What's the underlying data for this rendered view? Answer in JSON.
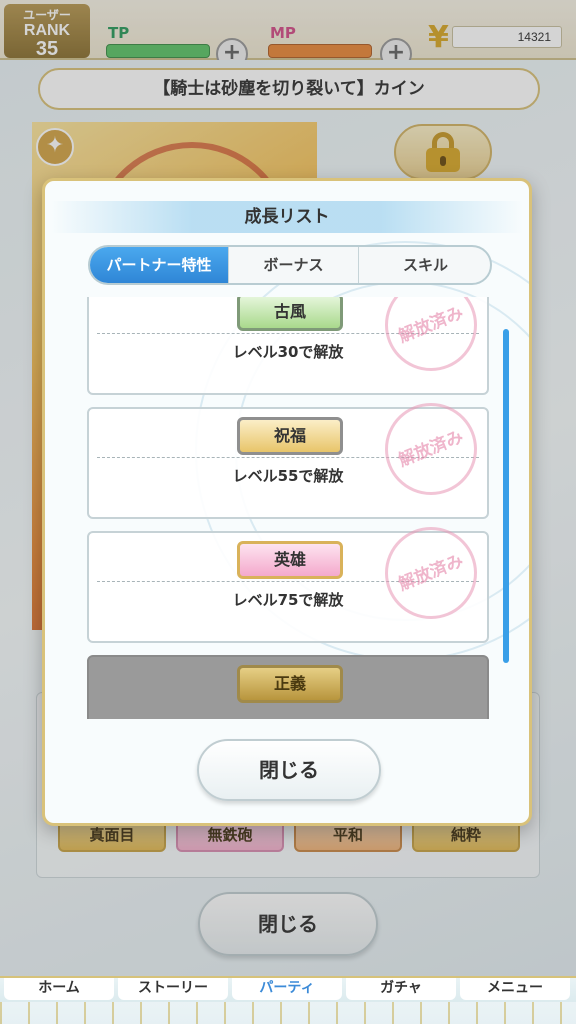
{
  "topbar": {
    "rank_line1": "ユーザー",
    "rank_line2": "RANK",
    "rank_value": "35",
    "tp_label": "TP",
    "mp_label": "MP",
    "plus": "+",
    "yen_icon": "¥",
    "coins": "14321"
  },
  "background": {
    "card_title": "【騎士は砂塵を切り裂いて】カイン",
    "star_icon": "✦",
    "tags": [
      "真面目",
      "無鉄砲",
      "平和",
      "純粋"
    ],
    "close_label": "閉じる",
    "nav": [
      "ホーム",
      "ストーリー",
      "パーティ",
      "ガチャ",
      "メニュー"
    ]
  },
  "modal": {
    "title": "成長リスト",
    "tabs": [
      "パートナー特性",
      "ボーナス",
      "スキル"
    ],
    "active_tab": "パートナー特性",
    "stamp_text": "解放済み",
    "items": [
      {
        "name": "古風",
        "unlock": "レベル30で解放",
        "released": true
      },
      {
        "name": "祝福",
        "unlock": "レベル55で解放",
        "released": true
      },
      {
        "name": "英雄",
        "unlock": "レベル75で解放",
        "released": true
      },
      {
        "name": "正義",
        "unlock": "",
        "released": false
      }
    ],
    "close_label": "閉じる"
  },
  "colors": {
    "accent_blue": "#2f86d6",
    "gold_border": "#d9c27a",
    "stamp_pink": "#e196b4"
  }
}
